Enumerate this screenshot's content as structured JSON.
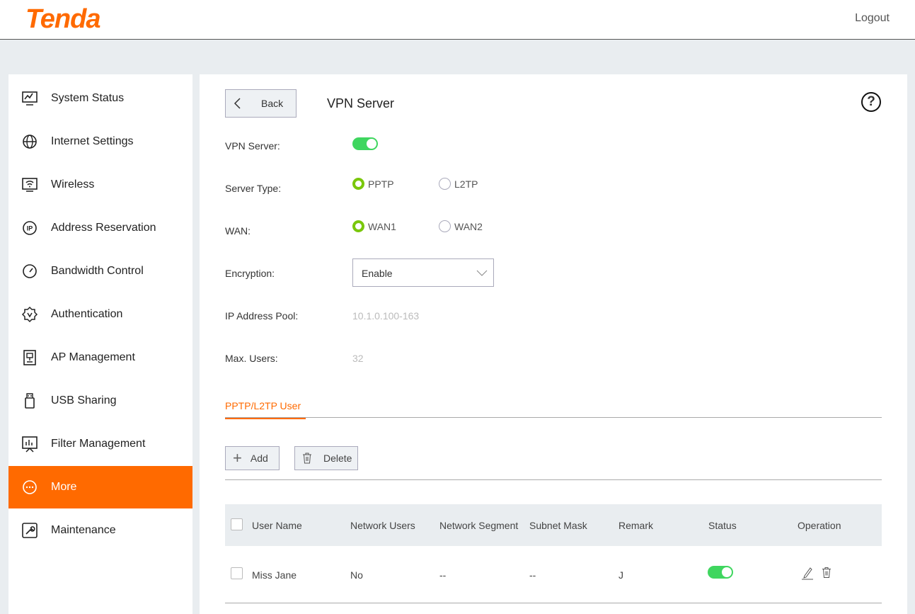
{
  "header": {
    "logo": "Tenda",
    "logout": "Logout"
  },
  "colors": {
    "accent": "#ff6a00",
    "toggle_on": "#3fd65f",
    "radio_on": "#7ac70c"
  },
  "sidebar": {
    "items": [
      {
        "label": "System Status",
        "icon": "monitor-chart-icon"
      },
      {
        "label": "Internet Settings",
        "icon": "globe-icon"
      },
      {
        "label": "Wireless",
        "icon": "wifi-icon"
      },
      {
        "label": "Address Reservation",
        "icon": "ip-icon"
      },
      {
        "label": "Bandwidth Control",
        "icon": "gauge-icon"
      },
      {
        "label": "Authentication",
        "icon": "badge-check-icon"
      },
      {
        "label": "AP Management",
        "icon": "ap-icon"
      },
      {
        "label": "USB Sharing",
        "icon": "usb-icon"
      },
      {
        "label": "Filter Management",
        "icon": "filter-board-icon"
      },
      {
        "label": "More",
        "icon": "more-icon",
        "active": true
      },
      {
        "label": "Maintenance",
        "icon": "wrench-icon"
      }
    ]
  },
  "page": {
    "back": "Back",
    "title": "VPN Server",
    "fields": {
      "vpn_server_label": "VPN Server:",
      "vpn_server_on": true,
      "server_type_label": "Server Type:",
      "server_type_options": [
        "PPTP",
        "L2TP"
      ],
      "server_type_selected": "PPTP",
      "wan_label": "WAN:",
      "wan_options": [
        "WAN1",
        "WAN2"
      ],
      "wan_selected": "WAN1",
      "encryption_label": "Encryption:",
      "encryption_value": "Enable",
      "ip_pool_label": "IP Address Pool:",
      "ip_pool_value": "10.1.0.100-163",
      "max_users_label": "Max. Users:",
      "max_users_value": "32"
    },
    "tab": "PPTP/L2TP User",
    "add": "Add",
    "delete": "Delete",
    "table": {
      "columns": [
        "User Name",
        "Network Users",
        "Network Segment",
        "Subnet Mask",
        "Remark",
        "Status",
        "Operation"
      ],
      "rows": [
        {
          "user_name": "Miss Jane",
          "network_users": "No",
          "network_segment": "--",
          "subnet_mask": "--",
          "remark": "J",
          "status_on": true
        }
      ]
    }
  }
}
